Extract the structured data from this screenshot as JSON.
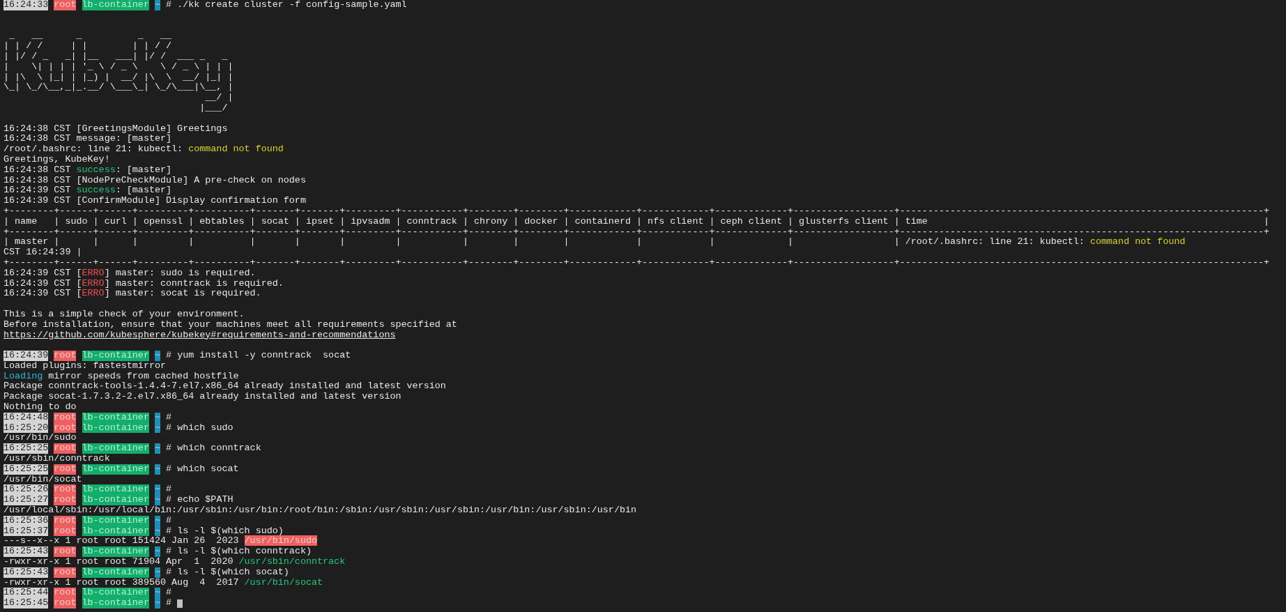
{
  "lines": [
    {
      "kind": "prompt",
      "time": "16:24:33",
      "user": "root",
      "host": "lb-container",
      "dir": "~",
      "symbol": "#",
      "command": "./kk create cluster -f config-sample.yaml",
      "cursor": false
    },
    {
      "kind": "blank"
    },
    {
      "kind": "blank"
    },
    {
      "kind": "art",
      "rows": [
        " _   __      _          _   __           ",
        "| | / /     | |        | | / /           ",
        "| |/ / _   _| |__   ___| |/ /  ___ _   _ ",
        "|    \\| | | | '_ \\ / _ \\    \\ / _ \\ | | |",
        "| |\\  \\ |_| | |_) |  __/ |\\  \\  __/ |_| |",
        "\\_| \\_/\\__,_|_.__/ \\___\\_| \\_/\\___|\\__, |",
        "                                    __/ |",
        "                                   |___/ "
      ]
    },
    {
      "kind": "blank"
    },
    {
      "kind": "text",
      "segments": [
        {
          "text": "16:24:38 CST [GreetingsModule] Greetings"
        }
      ]
    },
    {
      "kind": "text",
      "segments": [
        {
          "text": "16:24:38 CST message: [master]"
        }
      ]
    },
    {
      "kind": "text",
      "segments": [
        {
          "text": "/root/.bashrc: line 21: kubectl: "
        },
        {
          "text": "command not found",
          "color": "#d7d41a"
        }
      ]
    },
    {
      "kind": "text",
      "segments": [
        {
          "text": "Greetings, KubeKey!"
        }
      ]
    },
    {
      "kind": "text",
      "segments": [
        {
          "text": "16:24:38 CST "
        },
        {
          "text": "success",
          "color": "#23c87f"
        },
        {
          "text": ": [master]"
        }
      ]
    },
    {
      "kind": "text",
      "segments": [
        {
          "text": "16:24:38 CST [NodePreCheckModule] A pre-check on nodes"
        }
      ]
    },
    {
      "kind": "text",
      "segments": [
        {
          "text": "16:24:39 CST "
        },
        {
          "text": "success",
          "color": "#23c87f"
        },
        {
          "text": ": [master]"
        }
      ]
    },
    {
      "kind": "text",
      "segments": [
        {
          "text": "16:24:39 CST [ConfirmModule] Display confirmation form"
        }
      ]
    },
    {
      "kind": "table",
      "segments": [
        {
          "text": "+--------+------+------+---------+----------+-------+-------+---------+-----------+--------+--------+------------+------------+-------------+------------------+-----------------------------------------------------------------+"
        }
      ]
    },
    {
      "kind": "table",
      "segments": [
        {
          "text": "| name   | sudo | curl | openssl | ebtables | socat | ipset | ipvsadm | conntrack | chrony | docker | containerd | nfs client | ceph client | glusterfs client | time                                                            |"
        }
      ]
    },
    {
      "kind": "table",
      "segments": [
        {
          "text": "+--------+------+------+---------+----------+-------+-------+---------+-----------+--------+--------+------------+------------+-------------+------------------+-----------------------------------------------------------------+"
        }
      ]
    },
    {
      "kind": "table",
      "segments": [
        {
          "text": "| master |      |      |         |          |       |       |         |           |        |        |            |            |             |                  | /root/.bashrc: line 21: kubectl: "
        },
        {
          "text": "command not found",
          "color": "#d7d41a"
        }
      ]
    },
    {
      "kind": "table",
      "segments": [
        {
          "text": "CST 16:24:39 |"
        }
      ]
    },
    {
      "kind": "table",
      "segments": [
        {
          "text": "+--------+------+------+---------+----------+-------+-------+---------+-----------+--------+--------+------------+------------+-------------+------------------+-----------------------------------------------------------------+"
        }
      ]
    },
    {
      "kind": "text",
      "segments": [
        {
          "text": "16:24:39 CST ["
        },
        {
          "text": "ERRO",
          "color": "#f14c4c"
        },
        {
          "text": "] master: sudo is required."
        }
      ]
    },
    {
      "kind": "text",
      "segments": [
        {
          "text": "16:24:39 CST ["
        },
        {
          "text": "ERRO",
          "color": "#f14c4c"
        },
        {
          "text": "] master: conntrack is required."
        }
      ]
    },
    {
      "kind": "text",
      "segments": [
        {
          "text": "16:24:39 CST ["
        },
        {
          "text": "ERRO",
          "color": "#f14c4c"
        },
        {
          "text": "] master: socat is required."
        }
      ]
    },
    {
      "kind": "blank"
    },
    {
      "kind": "text",
      "segments": [
        {
          "text": "This is a simple check of your environment."
        }
      ]
    },
    {
      "kind": "text",
      "segments": [
        {
          "text": "Before installation, ensure that your machines meet all requirements specified at"
        }
      ]
    },
    {
      "kind": "link",
      "text": "https://github.com/kubesphere/kubekey#requirements-and-recommendations"
    },
    {
      "kind": "blank"
    },
    {
      "kind": "prompt",
      "time": "16:24:39",
      "user": "root",
      "host": "lb-container",
      "dir": "~",
      "symbol": "#",
      "command": "yum install -y conntrack  socat",
      "cursor": false
    },
    {
      "kind": "text",
      "segments": [
        {
          "text": "Loaded plugins: fastestmirror"
        }
      ]
    },
    {
      "kind": "text",
      "segments": [
        {
          "text": "Loading",
          "color": "#29b8db"
        },
        {
          "text": " mirror speeds from cached hostfile"
        }
      ]
    },
    {
      "kind": "text",
      "segments": [
        {
          "text": "Package conntrack-tools-1.4.4-7.el7.x86_64 already installed and latest version"
        }
      ]
    },
    {
      "kind": "text",
      "segments": [
        {
          "text": "Package socat-1.7.3.2-2.el7.x86_64 already installed and latest version"
        }
      ]
    },
    {
      "kind": "text",
      "segments": [
        {
          "text": "Nothing to do"
        }
      ]
    },
    {
      "kind": "prompt",
      "time": "16:24:48",
      "user": "root",
      "host": "lb-container",
      "dir": "~",
      "symbol": "#",
      "cursor": false
    },
    {
      "kind": "prompt",
      "time": "16:25:20",
      "user": "root",
      "host": "lb-container",
      "dir": "~",
      "symbol": "#",
      "command": "which sudo",
      "cursor": false
    },
    {
      "kind": "text",
      "segments": [
        {
          "text": "/usr/bin/sudo"
        }
      ]
    },
    {
      "kind": "prompt",
      "time": "16:25:25",
      "user": "root",
      "host": "lb-container",
      "dir": "~",
      "symbol": "#",
      "command": "which conntrack",
      "cursor": false
    },
    {
      "kind": "text",
      "segments": [
        {
          "text": "/usr/sbin/conntrack"
        }
      ]
    },
    {
      "kind": "prompt",
      "time": "16:25:25",
      "user": "root",
      "host": "lb-container",
      "dir": "~",
      "symbol": "#",
      "command": "which socat",
      "cursor": false
    },
    {
      "kind": "text",
      "segments": [
        {
          "text": "/usr/bin/socat"
        }
      ]
    },
    {
      "kind": "prompt",
      "time": "16:25:26",
      "user": "root",
      "host": "lb-container",
      "dir": "~",
      "symbol": "#",
      "cursor": false
    },
    {
      "kind": "prompt",
      "time": "16:25:27",
      "user": "root",
      "host": "lb-container",
      "dir": "~",
      "symbol": "#",
      "command": "echo $PATH",
      "cursor": false
    },
    {
      "kind": "text",
      "segments": [
        {
          "text": "/usr/local/sbin:/usr/local/bin:/usr/sbin:/usr/bin:/root/bin:/sbin:/usr/sbin:/usr/sbin:/usr/bin:/usr/sbin:/usr/bin"
        }
      ]
    },
    {
      "kind": "prompt",
      "time": "16:25:36",
      "user": "root",
      "host": "lb-container",
      "dir": "~",
      "symbol": "#",
      "cursor": false
    },
    {
      "kind": "prompt",
      "time": "16:25:37",
      "user": "root",
      "host": "lb-container",
      "dir": "~",
      "symbol": "#",
      "command": "ls -l $(which sudo)",
      "cursor": false
    },
    {
      "kind": "text",
      "segments": [
        {
          "text": "---s--x--x 1 root root 151424 Jan 26  2023 "
        },
        {
          "text": "/usr/bin/sudo",
          "kind": "highlight",
          "color": "#f06060"
        }
      ]
    },
    {
      "kind": "prompt",
      "time": "16:25:43",
      "user": "root",
      "host": "lb-container",
      "dir": "~",
      "symbol": "#",
      "command": "ls -l $(which conntrack)",
      "cursor": false
    },
    {
      "kind": "text",
      "segments": [
        {
          "text": "-rwxr-xr-x 1 root root 71904 Apr  1  2020 "
        },
        {
          "text": "/usr/sbin/conntrack",
          "color": "#23c87f"
        }
      ]
    },
    {
      "kind": "prompt",
      "time": "16:25:43",
      "user": "root",
      "host": "lb-container",
      "dir": "~",
      "symbol": "#",
      "command": "ls -l $(which socat)",
      "cursor": false
    },
    {
      "kind": "text",
      "segments": [
        {
          "text": "-rwxr-xr-x 1 root root 389560 Aug  4  2017 "
        },
        {
          "text": "/usr/bin/socat",
          "color": "#23c87f"
        }
      ]
    },
    {
      "kind": "prompt",
      "time": "16:25:44",
      "user": "root",
      "host": "lb-container",
      "dir": "~",
      "symbol": "#",
      "cursor": false
    },
    {
      "kind": "prompt",
      "time": "16:25:45",
      "user": "root",
      "host": "lb-container",
      "dir": "~",
      "symbol": "#",
      "cursor": true
    }
  ]
}
